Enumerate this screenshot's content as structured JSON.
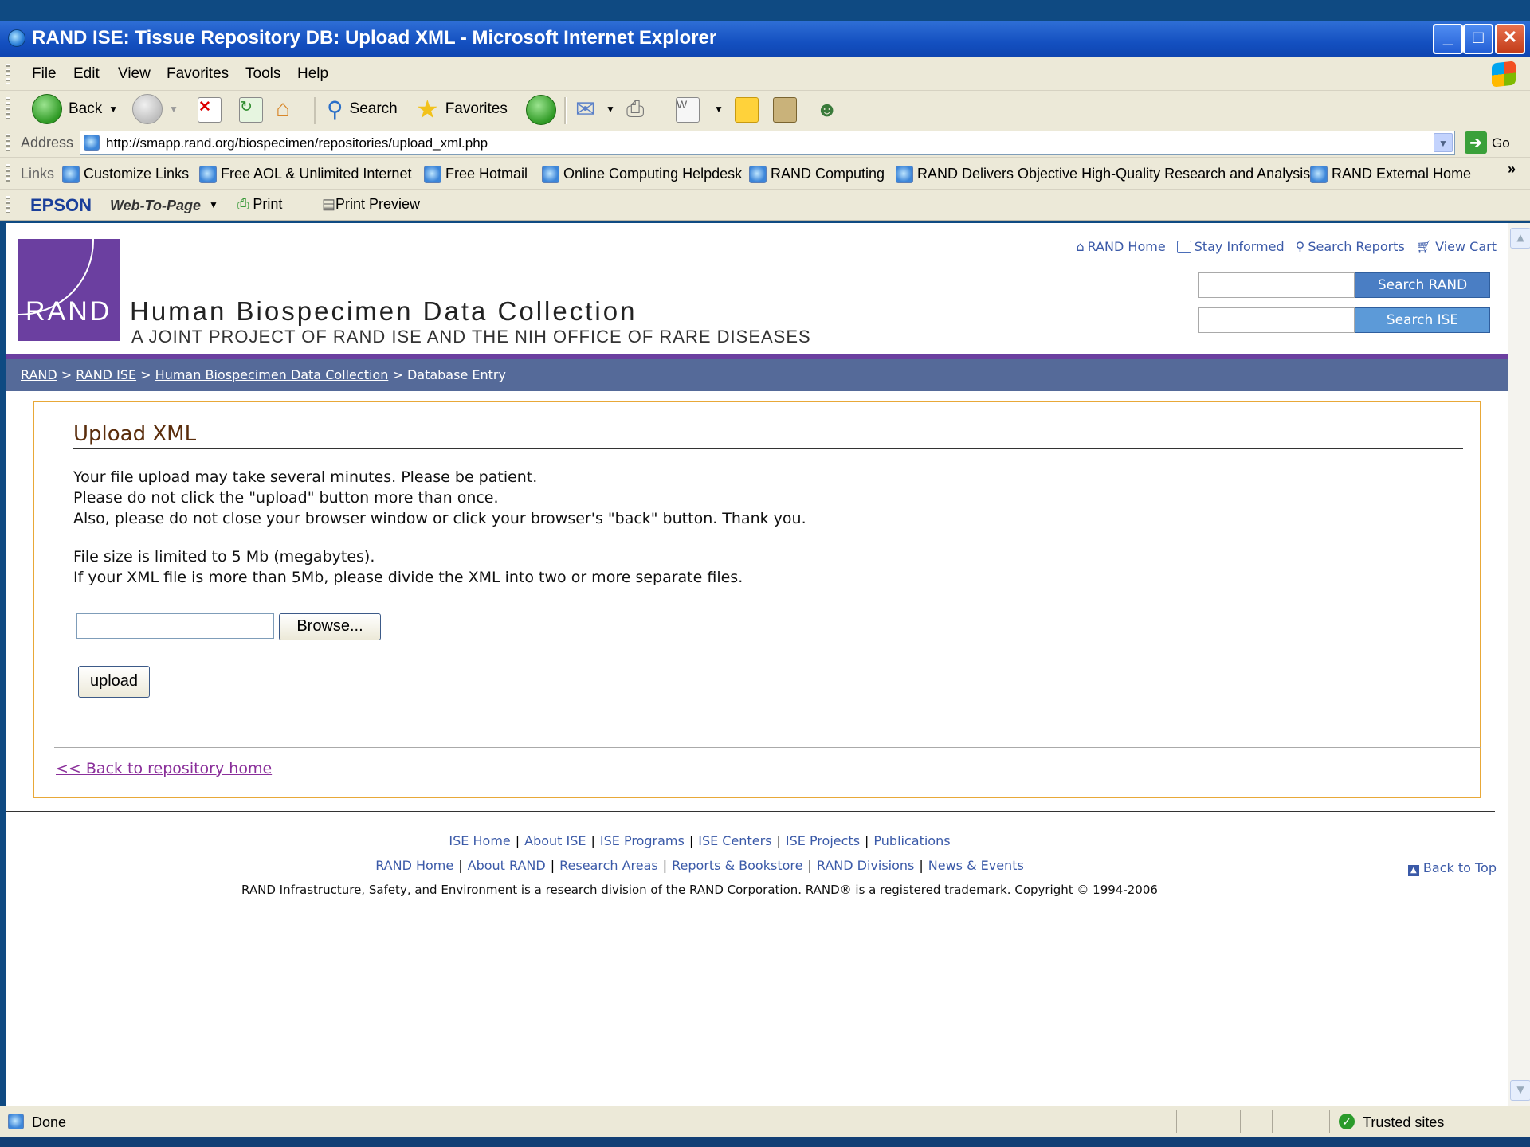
{
  "window": {
    "title": "RAND ISE: Tissue Repository DB: Upload XML - Microsoft Internet Explorer",
    "minimize": "_",
    "maximize": "□",
    "close": "✕"
  },
  "menu": [
    "File",
    "Edit",
    "View",
    "Favorites",
    "Tools",
    "Help"
  ],
  "toolbar": {
    "back": "Back",
    "search": "Search",
    "favorites": "Favorites"
  },
  "address": {
    "label": "Address",
    "url": "http://smapp.rand.org/biospecimen/repositories/upload_xml.php",
    "go": "Go"
  },
  "links": {
    "label": "Links",
    "items": [
      "Customize Links",
      "Free AOL & Unlimited Internet",
      "Free Hotmail",
      "Online Computing Helpdesk",
      "RAND Computing",
      "RAND Delivers Objective High-Quality Research and Analysis",
      "RAND External Home"
    ],
    "more": "»"
  },
  "epson": {
    "brand": "EPSON",
    "web_to_page": "Web-To-Page",
    "print": "Print",
    "print_preview": "Print Preview"
  },
  "site": {
    "logo_text": "RAND",
    "title": "Human Biospecimen Data Collection",
    "subtitle": "A JOINT PROJECT OF RAND ISE AND THE NIH OFFICE OF RARE DISEASES",
    "top_links": [
      "RAND Home",
      "Stay Informed",
      "Search Reports",
      "View Cart"
    ],
    "search_rand": "Search RAND",
    "search_ise": "Search ISE"
  },
  "breadcrumb": {
    "items": [
      "RAND",
      "RAND ISE",
      "Human Biospecimen Data Collection"
    ],
    "current": "Database Entry",
    "sep": ">"
  },
  "main": {
    "heading": "Upload XML",
    "lines1": [
      "Your file upload may take several minutes. Please be patient.",
      "Please do not click the \"upload\" button more than once.",
      "Also, please do not close your browser window or click your browser's \"back\" button. Thank you."
    ],
    "lines2": [
      "File size is limited to 5 Mb (megabytes).",
      "If your XML file is more than 5Mb, please divide the XML into two or more separate files."
    ],
    "browse": "Browse...",
    "upload": "upload",
    "back_link": "<< Back to repository home"
  },
  "footer": {
    "row1": [
      "ISE Home",
      "About ISE",
      "ISE Programs",
      "ISE Centers",
      "ISE Projects",
      "Publications"
    ],
    "row2": [
      "RAND Home",
      "About RAND",
      "Research Areas",
      "Reports & Bookstore",
      "RAND Divisions",
      "News & Events"
    ],
    "copyright": "RAND Infrastructure, Safety, and Environment is a research division of the RAND Corporation. RAND® is a registered trademark. Copyright © 1994-2006",
    "back_to_top": "Back to Top"
  },
  "status": {
    "text": "Done",
    "zone": "Trusted sites"
  }
}
